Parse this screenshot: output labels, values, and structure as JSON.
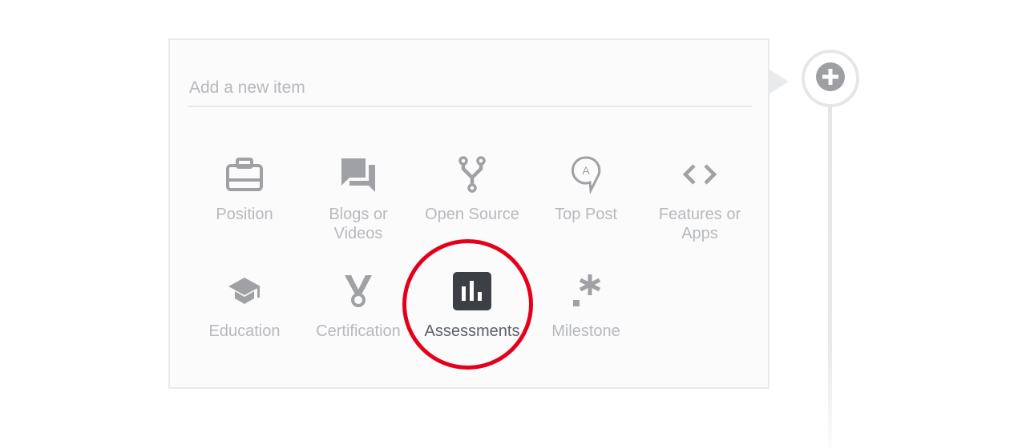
{
  "composer": {
    "input_value": "",
    "input_placeholder": "Add a new item"
  },
  "add_button": {
    "icon": "plus-circle-icon"
  },
  "item_types": [
    {
      "label": "Position",
      "icon": "briefcase-icon",
      "active": false
    },
    {
      "label": "Blogs or Videos",
      "icon": "chat-bubbles-icon",
      "active": false
    },
    {
      "label": "Open Source",
      "icon": "fork-icon",
      "active": false
    },
    {
      "label": "Top Post",
      "icon": "post-pin-icon",
      "active": false
    },
    {
      "label": "Features or Apps",
      "icon": "code-brackets-icon",
      "active": false
    },
    {
      "label": "Education",
      "icon": "graduation-cap-icon",
      "active": false
    },
    {
      "label": "Certification",
      "icon": "medal-icon",
      "active": false
    },
    {
      "label": "Assessments",
      "icon": "bar-chart-icon",
      "active": true
    },
    {
      "label": "Milestone",
      "icon": "asterisk-icon",
      "active": false
    }
  ],
  "colors": {
    "icon_default": "#a0a1a5",
    "icon_active": "#3c3f43",
    "highlight_ring": "#e4001b"
  }
}
